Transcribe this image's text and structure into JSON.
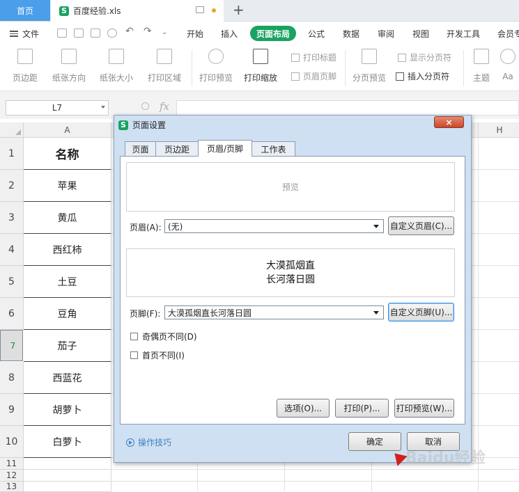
{
  "tabs": {
    "home": "首页",
    "document": "百度经验.xls",
    "add": "+"
  },
  "menu": {
    "file": "文件",
    "tabs": [
      "开始",
      "插入",
      "页面布局",
      "公式",
      "数据",
      "审阅",
      "视图",
      "开发工具",
      "会员专"
    ],
    "active": "页面布局"
  },
  "ribbon": {
    "margins": "页边距",
    "orientation": "纸张方向",
    "size": "纸张大小",
    "print_area": "打印区域",
    "print_preview": "打印预览",
    "print_scale": "打印缩放",
    "print_titles": "打印标题",
    "header_footer": "页眉页脚",
    "page_break_preview": "分页预览",
    "show_page_breaks": "显示分页符",
    "insert_page_break": "插入分页符",
    "theme": "主题",
    "font": "Aa"
  },
  "formula_bar": {
    "cell_ref": "L7",
    "fx": "fx",
    "formula": ""
  },
  "sheet": {
    "col_a": "A",
    "col_h": "H",
    "rows": [
      {
        "num": "1",
        "value": "名称"
      },
      {
        "num": "2",
        "value": "苹果"
      },
      {
        "num": "3",
        "value": "黄瓜"
      },
      {
        "num": "4",
        "value": "西红柿"
      },
      {
        "num": "5",
        "value": "土豆"
      },
      {
        "num": "6",
        "value": "豆角"
      },
      {
        "num": "7",
        "value": "茄子"
      },
      {
        "num": "8",
        "value": "西蓝花"
      },
      {
        "num": "9",
        "value": "胡萝卜"
      },
      {
        "num": "10",
        "value": "白萝卜"
      },
      {
        "num": "11",
        "value": ""
      },
      {
        "num": "12",
        "value": ""
      },
      {
        "num": "13",
        "value": ""
      }
    ],
    "selected_row": "7"
  },
  "dialog": {
    "title": "页面设置",
    "close": "×",
    "tabs": [
      "页面",
      "页边距",
      "页眉/页脚",
      "工作表"
    ],
    "active_tab": "页眉/页脚",
    "header_preview": "预览",
    "header_label": "页眉(A):",
    "header_value": "(无)",
    "custom_header": "自定义页眉(C)...",
    "footer_line1": "大漠孤烟直",
    "footer_line2": "长河落日圆",
    "footer_label": "页脚(F):",
    "footer_value": "大漠孤烟直长河落日圆",
    "custom_footer": "自定义页脚(U)...",
    "odd_even": "奇偶页不同(D)",
    "first_page": "首页不同(I)",
    "options": "选项(O)...",
    "print": "打印(P)...",
    "print_preview": "打印预览(W)...",
    "tips": "操作技巧",
    "ok": "确定",
    "cancel": "取消"
  },
  "watermark": "Baidu经验",
  "colors": {
    "brand_green": "#1aa260",
    "home_tab_blue": "#4b9eea",
    "dialog_bg": "#cfe0f2",
    "link_blue": "#3b82c4"
  }
}
